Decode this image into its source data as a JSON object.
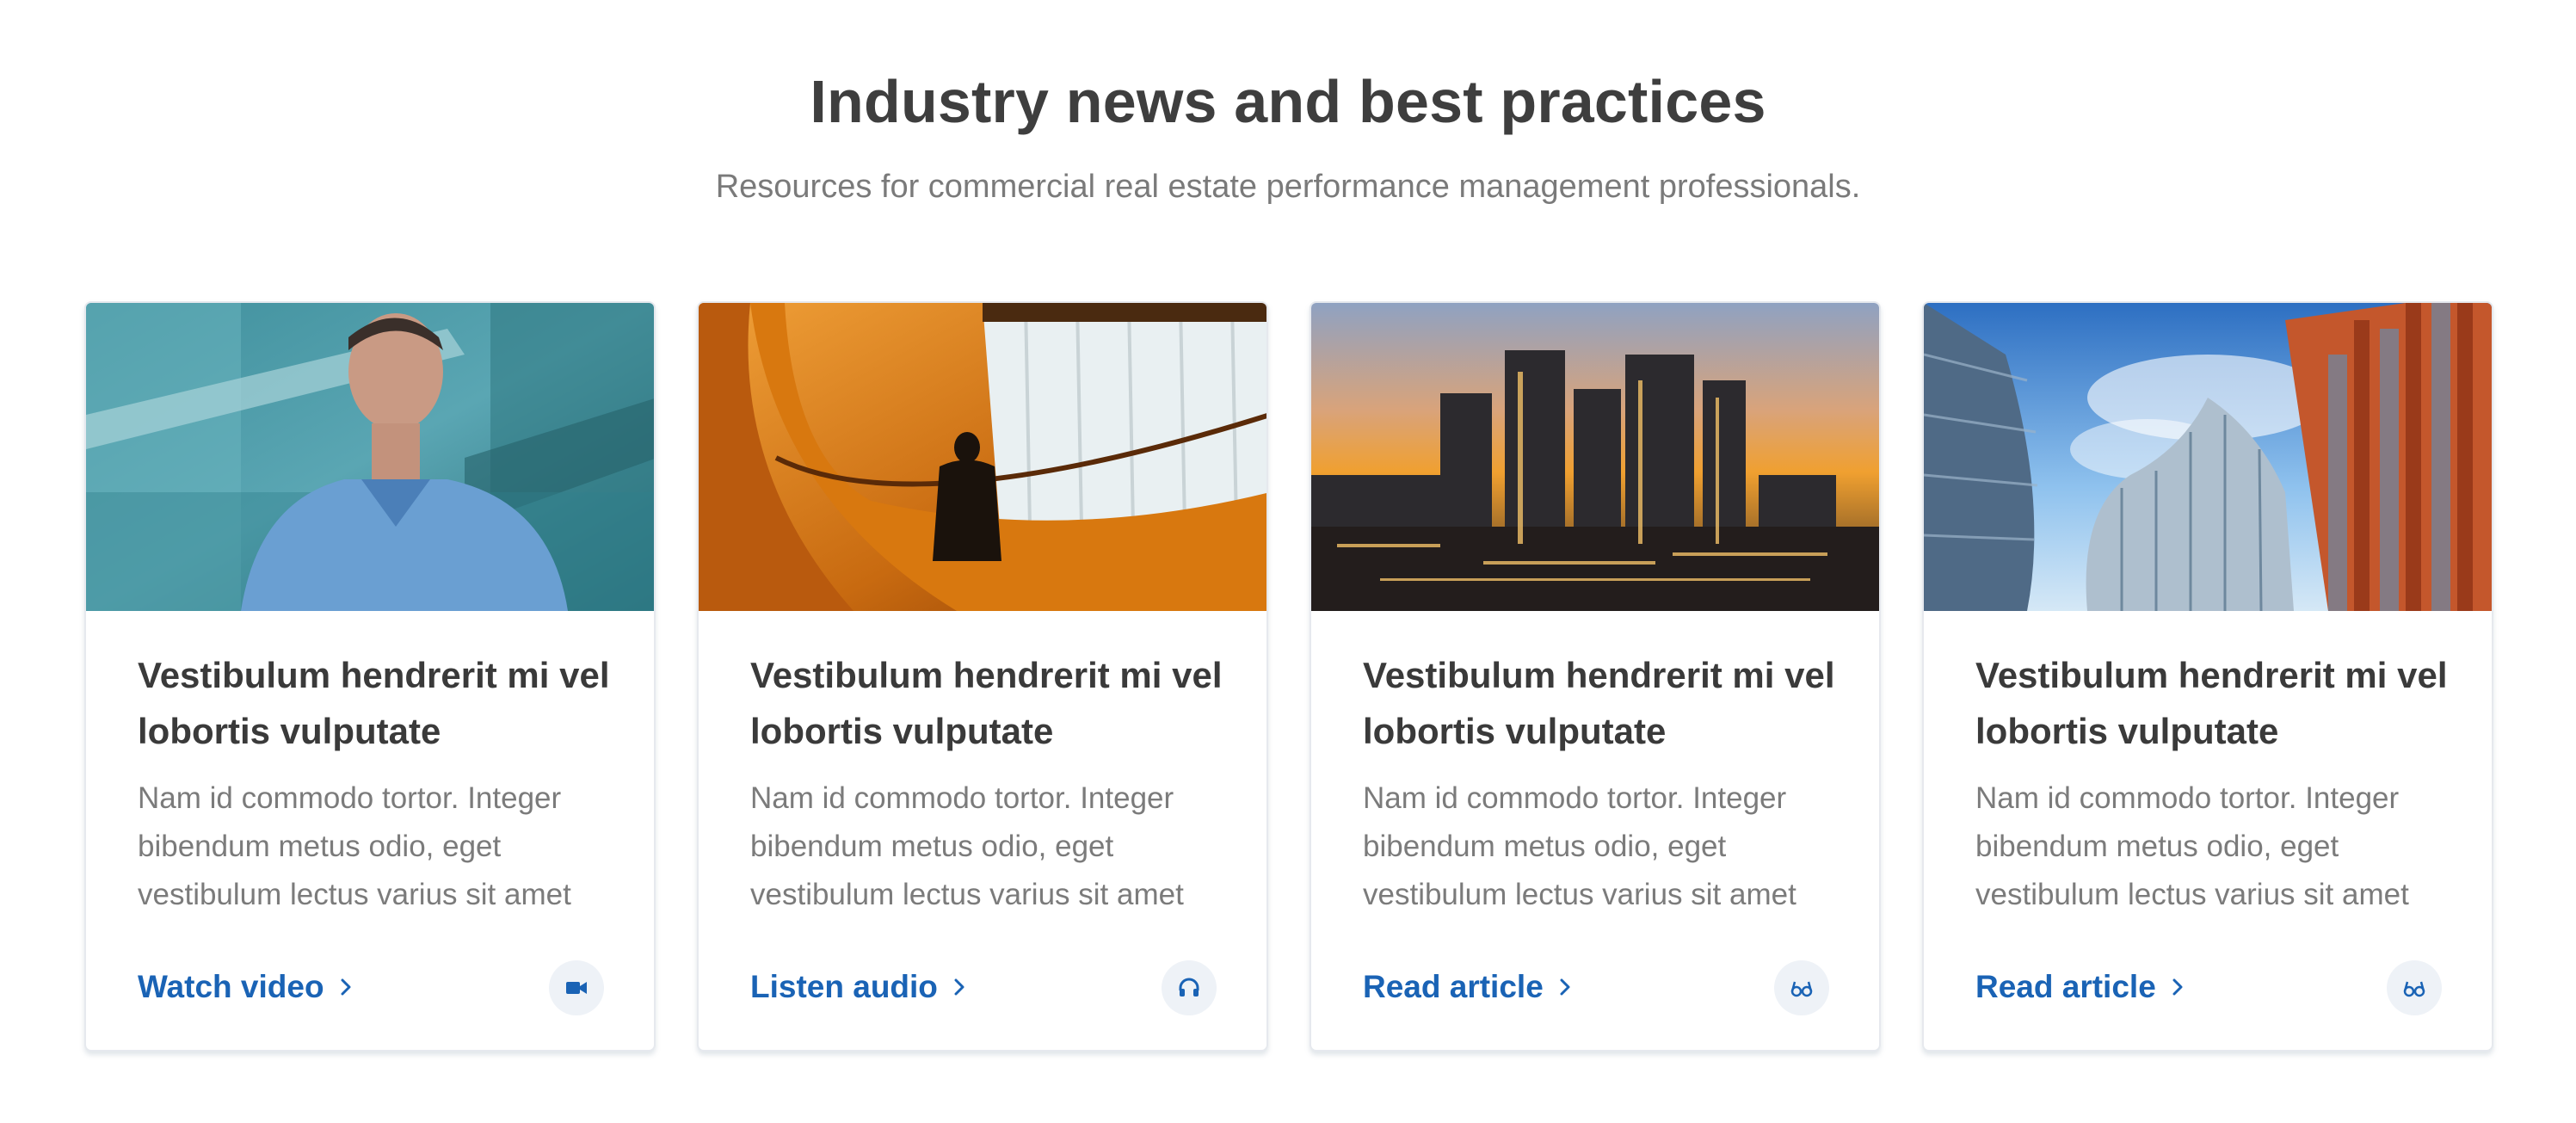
{
  "header": {
    "title": "Industry news and best practices",
    "subtitle": "Resources for commercial real estate performance management professionals."
  },
  "colors": {
    "link": "#1a63b5",
    "title": "#3a3a3a",
    "body": "#7b7b7b",
    "icon_badge_bg": "#eef2f7"
  },
  "cards": [
    {
      "image": "man-on-staircase-photo",
      "title": "Vestibulum hendrerit mi vel lobortis vulputate",
      "body": "Nam id commodo tortor. Integer bibendum metus odio, eget vestibulum lectus varius sit amet",
      "link_label": "Watch video",
      "icon": "video-camera-icon"
    },
    {
      "image": "silhouette-escalator-photo",
      "title": "Vestibulum hendrerit mi vel lobortis vulputate",
      "body": "Nam id commodo tortor. Integer bibendum metus odio, eget vestibulum lectus varius sit amet",
      "link_label": "Listen audio",
      "icon": "headphones-icon"
    },
    {
      "image": "city-skyline-sunset-photo",
      "title": "Vestibulum hendrerit mi vel lobortis vulputate",
      "body": "Nam id commodo tortor. Integer bibendum metus odio, eget vestibulum lectus varius sit amet",
      "link_label": "Read article",
      "icon": "reading-glasses-icon"
    },
    {
      "image": "glass-skyscrapers-photo",
      "title": "Vestibulum hendrerit mi vel lobortis vulputate",
      "body": "Nam id commodo tortor. Integer bibendum metus odio, eget vestibulum lectus varius sit amet",
      "link_label": "Read article",
      "icon": "reading-glasses-icon"
    }
  ]
}
